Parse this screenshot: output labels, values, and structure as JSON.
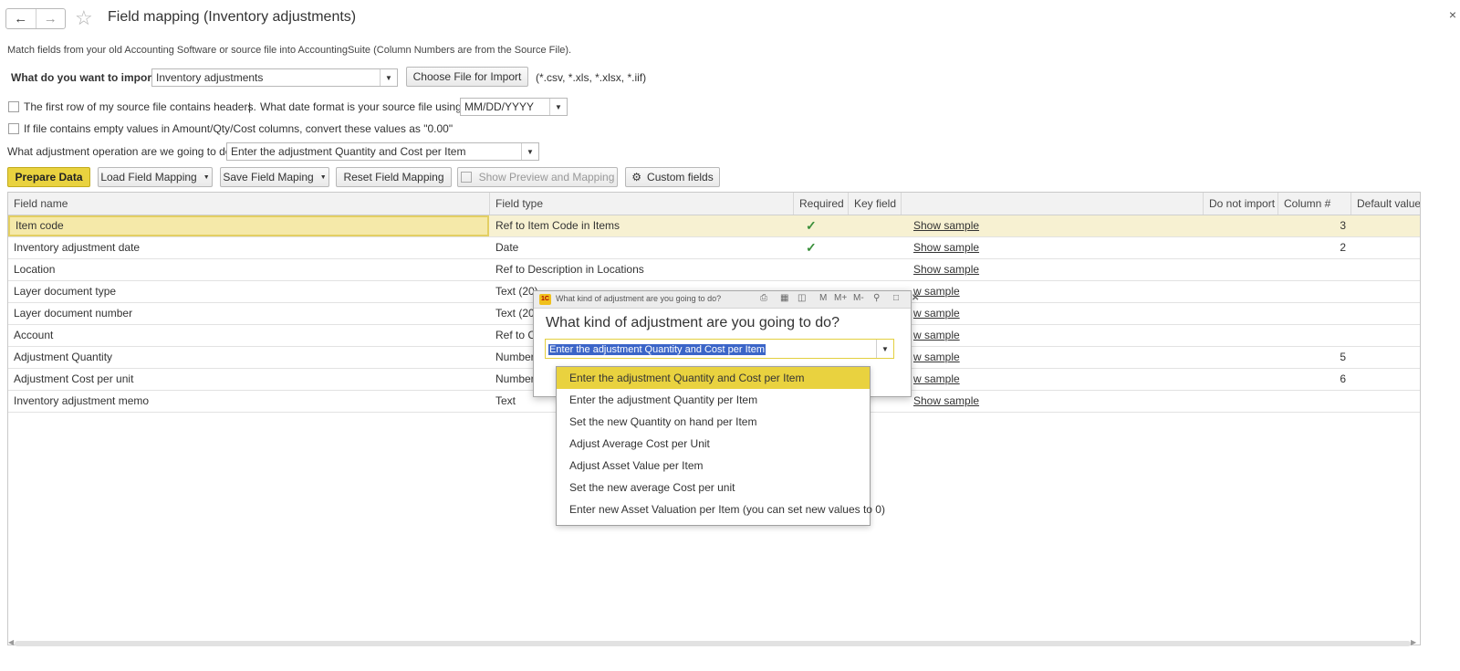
{
  "window": {
    "title": "Field mapping (Inventory adjustments)",
    "close": "×"
  },
  "icons": {
    "back": "back-arrow-icon",
    "forward": "forward-arrow-icon",
    "favorite": "star-icon"
  },
  "hint": "Match fields from your old Accounting Software or source file into AccountingSuite (Column Numbers are from the Source File).",
  "import": {
    "label": "What do you want to import?",
    "value": "Inventory adjustments",
    "choose_button": "Choose File for Import",
    "extensions": "(*.csv, *.xls, *.xlsx, *.iif)"
  },
  "options": {
    "headers_label": "The first row of my source file contains headers.",
    "separator": "|",
    "date_format_label": "What date format is your source file using?:",
    "date_format_value": "MM/DD/YYYY",
    "empty_values_label": "If file contains empty values in Amount/Qty/Cost columns, convert these values as \"0.00\"",
    "operation_label": "What adjustment operation are we going to do:",
    "operation_value": "Enter the adjustment Quantity and Cost per Item"
  },
  "toolbar": {
    "prepare": "Prepare Data",
    "load": "Load Field Mapping",
    "save": "Save Field Maping",
    "reset": "Reset Field Mapping",
    "preview": "Show Preview and Mapping",
    "custom": "Custom fields"
  },
  "table": {
    "columns": [
      "Field name",
      "Field type",
      "Required",
      "Key field",
      "",
      "Do not import",
      "Column #",
      "Default value"
    ],
    "rows": [
      {
        "name": "Item code",
        "type": "Ref to Item Code in Items",
        "required": "✓",
        "sample": "Show sample",
        "column": "3"
      },
      {
        "name": "Inventory adjustment date",
        "type": "Date",
        "required": "✓",
        "sample": "Show sample",
        "column": "2"
      },
      {
        "name": "Location",
        "type": "Ref to Description in Locations",
        "required": "",
        "sample": "Show sample",
        "column": ""
      },
      {
        "name": "Layer document type",
        "type": "Text (20)",
        "required": "",
        "sample": "w sample",
        "column": ""
      },
      {
        "name": "Layer document number",
        "type": "Text (20)",
        "required": "",
        "sample": "w sample",
        "column": ""
      },
      {
        "name": "Account",
        "type": "Ref to Coc",
        "required": "",
        "sample": "w sample",
        "column": ""
      },
      {
        "name": "Adjustment Quantity",
        "type": "Number (8",
        "required": "",
        "sample": "w sample",
        "column": "5"
      },
      {
        "name": "Adjustment Cost per unit",
        "type": "Number (1",
        "required": "",
        "sample": "w sample",
        "column": "6"
      },
      {
        "name": "Inventory adjustment memo",
        "type": "Text",
        "required": "",
        "sample": "Show sample",
        "column": ""
      }
    ]
  },
  "dialog": {
    "title": "What kind of adjustment are you going to do?",
    "heading": "What kind of adjustment are you going to do?",
    "value": "Enter the adjustment Quantity and Cost per Item",
    "tools": [
      "M",
      "M+",
      "M-"
    ],
    "options": [
      "Enter the adjustment Quantity and Cost per Item",
      "Enter the adjustment Quantity per Item",
      "Set the new Quantity on hand per Item",
      "Adjust Average Cost per Unit",
      "Adjust Asset Value per Item",
      "Set the new average Cost per unit",
      "Enter new Asset Valuation per Item (you can set new values to 0)"
    ]
  }
}
